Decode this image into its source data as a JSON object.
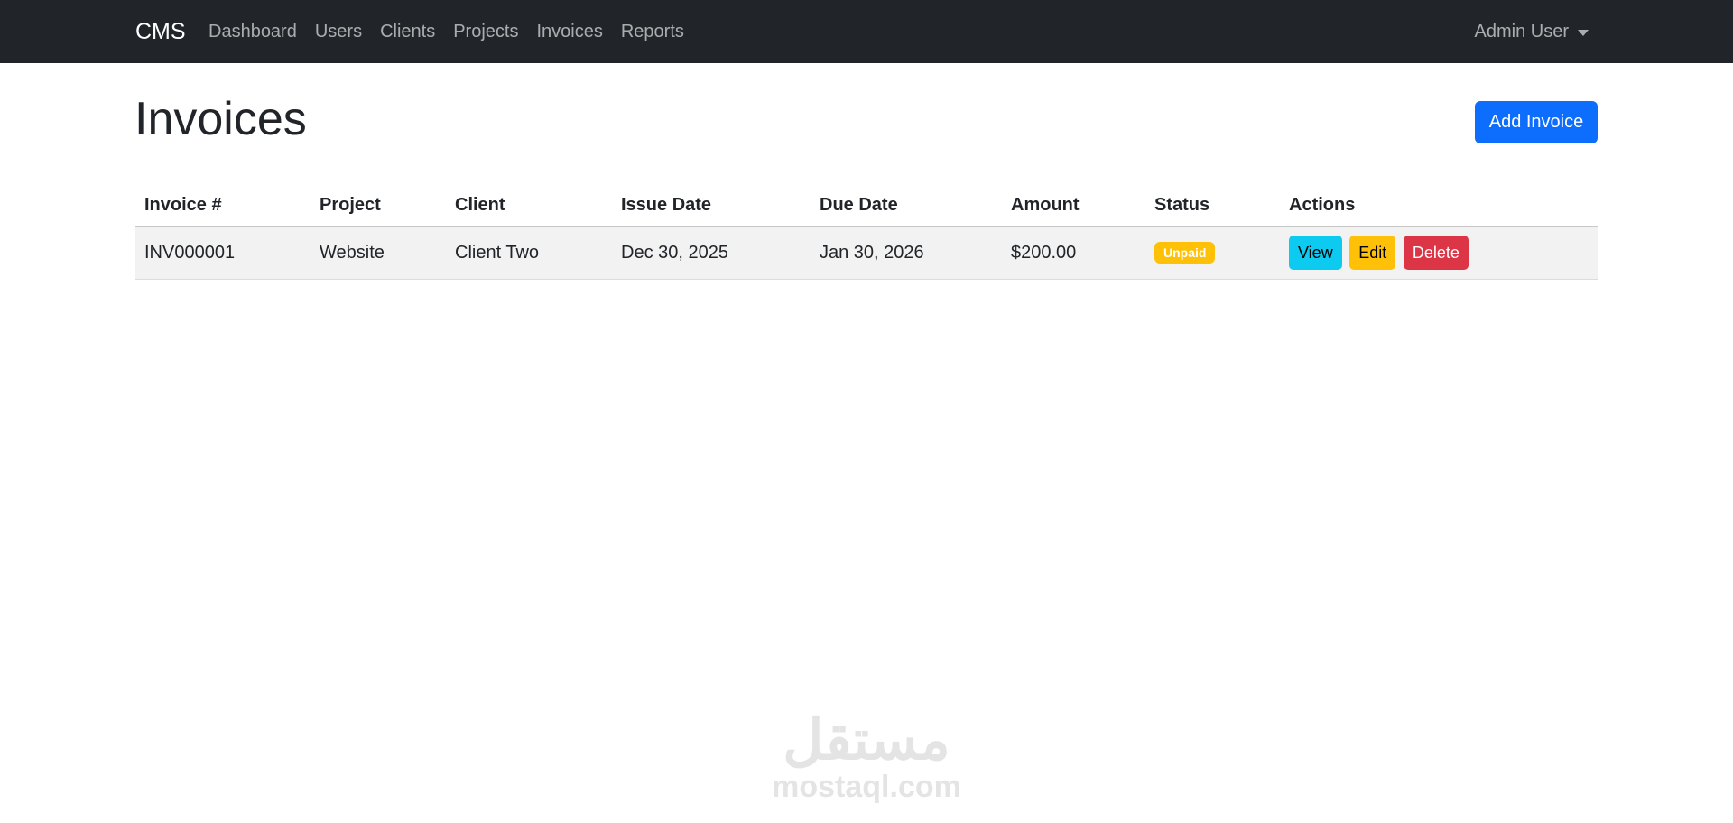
{
  "navbar": {
    "brand": "CMS",
    "links": [
      "Dashboard",
      "Users",
      "Clients",
      "Projects",
      "Invoices",
      "Reports"
    ],
    "user": "Admin User"
  },
  "page": {
    "title": "Invoices",
    "add_button": "Add Invoice"
  },
  "table": {
    "headers": [
      "Invoice #",
      "Project",
      "Client",
      "Issue Date",
      "Due Date",
      "Amount",
      "Status",
      "Actions"
    ],
    "rows": [
      {
        "invoice": "INV000001",
        "project": "Website",
        "client": "Client Two",
        "issue_date": "Dec 30, 2025",
        "due_date": "Jan 30, 2026",
        "amount": "$200.00",
        "status": "Unpaid"
      }
    ],
    "actions": {
      "view": "View",
      "edit": "Edit",
      "delete": "Delete"
    }
  },
  "watermark": {
    "arabic": "مستقل",
    "latin": "mostaql.com"
  },
  "colors": {
    "navbar_bg": "#212529",
    "primary": "#0d6efd",
    "info": "#0dcaf0",
    "warning": "#ffc107",
    "danger": "#dc3545"
  }
}
